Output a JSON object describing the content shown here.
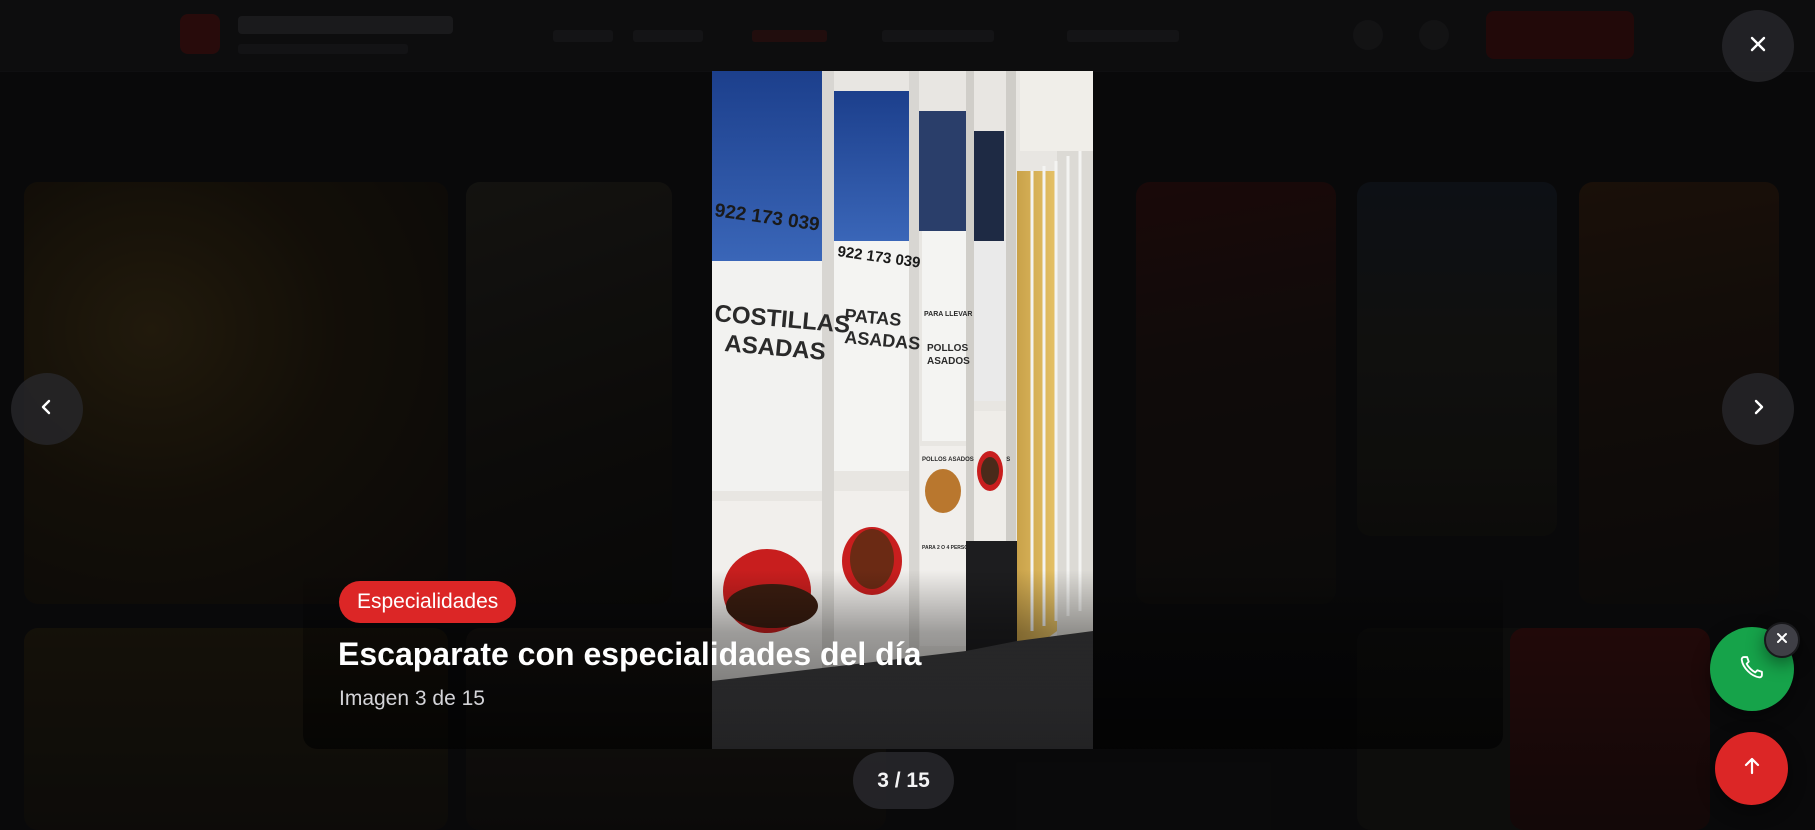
{
  "lightbox": {
    "category_badge": "Especialidades",
    "title": "Escaparate con especialidades del día",
    "subtitle": "Imagen 3 de 15",
    "counter": "3 / 15",
    "image": {
      "phone_number": "922 173 039",
      "sign_costillas": "COSTILLAS",
      "sign_asadas": "ASADAS",
      "sign_patas": "PATAS",
      "sign_patas_asadas": "ASADAS",
      "sign_para_llevar": "PARA LLEVAR",
      "sign_pollos": "POLLOS",
      "sign_pollos_asados": "ASADOS",
      "sign_pollos_con_papas": "POLLOS ASADOS CON PAPAS",
      "sign_personas": "PARA 2 O 4 PERSONAS"
    }
  },
  "icons": {
    "close": "close-icon",
    "prev": "chevron-left-icon",
    "next": "chevron-right-icon",
    "phone": "phone-icon",
    "dismiss": "close-icon",
    "scroll_top": "arrow-up-icon"
  },
  "colors": {
    "accent_red": "#dc2626",
    "phone_green": "#16a34a"
  }
}
